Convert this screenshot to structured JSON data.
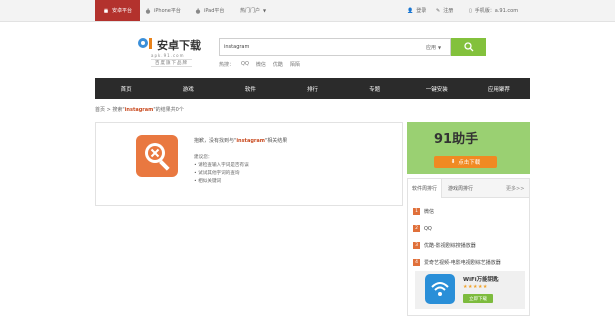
{
  "topbar": {
    "platforms": [
      {
        "label": "安卓平台",
        "icon": "android-icon",
        "active": true
      },
      {
        "label": "iPhone平台",
        "icon": "apple-icon",
        "active": false
      },
      {
        "label": "iPad平台",
        "icon": "apple-icon",
        "active": false
      },
      {
        "label": "热门门户",
        "icon": "",
        "active": false
      }
    ],
    "login": "登录",
    "register": "注册",
    "mobile_label": "手机版：",
    "mobile_url": "a.91.com"
  },
  "header": {
    "logo_title": "安卓下载",
    "logo_sub": "apk.91.com",
    "logo_slogan": "百度旗下品牌",
    "search": {
      "value": "instagram",
      "type": "应用"
    },
    "hotwords_label": "热搜：",
    "hotwords": [
      "QQ",
      "微信",
      "优酷",
      "陌陌"
    ]
  },
  "nav": [
    "首页",
    "游戏",
    "软件",
    "排行",
    "专题",
    "一键安装",
    "应用聚荐"
  ],
  "breadcrumb": {
    "home": "首页",
    "sep": ">",
    "prefix": "搜索\"",
    "keyword": "instagram",
    "suffix": "\"的结果共0个"
  },
  "result": {
    "msg_prefix": "抱歉，没有找到与\"",
    "keyword": "instagram",
    "msg_suffix": "\"相关结果",
    "tips_title": "建议您：",
    "tips": [
      "• 请检查输入字词是否有误",
      "• 试试其他字词的查询",
      "• 相似关键词"
    ]
  },
  "sidebar": {
    "promo_brand": "91助手",
    "promo_button": "点击下载",
    "tabs": [
      "软件周排行",
      "游戏周排行"
    ],
    "more": "更多>>",
    "rank": [
      {
        "num": "1",
        "name": "微信"
      },
      {
        "num": "2",
        "name": "QQ"
      },
      {
        "num": "3",
        "name": "优酷-影视剧综搜播放器"
      },
      {
        "num": "4",
        "name": "爱奇艺视频-电影电视剧综艺播放器"
      }
    ],
    "featured": {
      "name": "WiFi万能钥匙",
      "stars": "★★★★★",
      "button": "立即下载"
    }
  },
  "colors": {
    "accent_red": "#b3322d",
    "nav_bg": "#2b2b2b",
    "search_green": "#83c13c",
    "promo_green": "#9ad072",
    "keyword_orange": "#c94a1f"
  }
}
